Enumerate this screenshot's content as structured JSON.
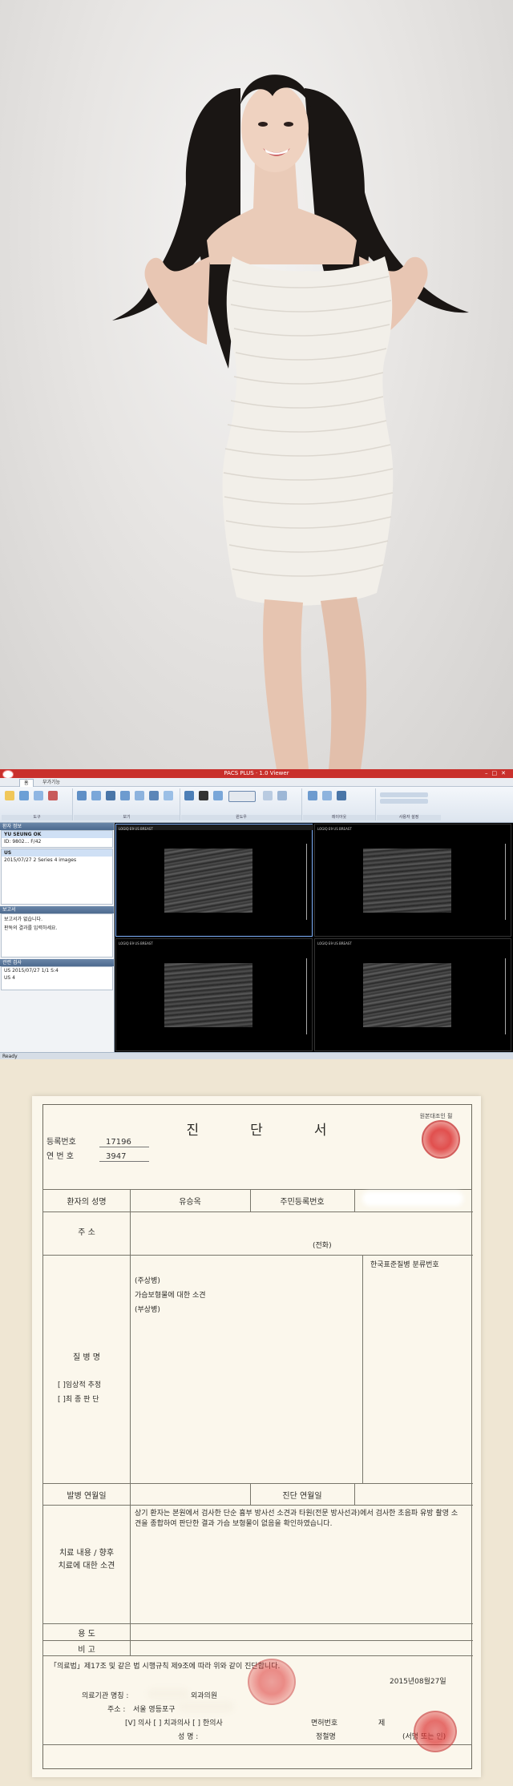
{
  "photo": {
    "subject": "woman in white bandage dress holding her long dark hair"
  },
  "viewer": {
    "window_title": "PACS PLUS · 1.0 Viewer",
    "tabs": [
      "홈",
      "부가기능"
    ],
    "ribbon_groups": [
      "도구",
      "보기",
      "윈도우",
      "레이아웃",
      "사용자 설정"
    ],
    "left_panel": {
      "patient_header": "환자 정보",
      "patient_name": "YU SEUNG OK",
      "patient_id": "ID: 9802... F/42",
      "study_header": "US",
      "study_line": "2015/07/27  2 Series  4 images",
      "report_header": "보고서",
      "report_lines": [
        "보고서가 없습니다.",
        "판독의 결과를 입력하세요."
      ],
      "related_header": "관련 검사",
      "related_lines": [
        "US 2015/07/27 1/1 S:4",
        "US  4"
      ]
    },
    "cell_info": "LOGIQ E9  US BREAST",
    "status": "Ready"
  },
  "doc": {
    "title_chars": [
      "진",
      "단",
      "서"
    ],
    "copy_label": "원본대조인 필",
    "reg_no_label": "등록번호",
    "reg_no": "17196",
    "serial_label": "연 번 호",
    "serial": "3947",
    "patient_name_label": "환자의 성명",
    "patient_name": "유승옥",
    "rrn_label": "주민등록번호",
    "address_label": "주    소",
    "phone_label": "(전화)",
    "kcd_label": "한국표준질병 분류번호",
    "main_dx_label": "(주상병)",
    "main_dx": "가슴보형물에 대한 소견",
    "sub_dx_label": "(부상병)",
    "disease_label": "질 병 명",
    "clinical_label": "[  ]임상적 추정",
    "final_label": "[  ]최 종 판 단",
    "onset_label": "발병 연월일",
    "dx_date_label": "진단 연월일",
    "treatment_label_1": "치료 내용 / 향후",
    "treatment_label_2": "치료에 대한 소견",
    "opinion": "상기 환자는 본원에서 검사한 단순 흉부 방사선 소견과 타원(전문 방사선과)에서 검사한 초음파 유방 촬영 소견을 종합하여 판단한 결과 가슴 보형물이 없음을 확인하였습니다.",
    "usage_label": "용    도",
    "remarks_label": "비    고",
    "law_text": "「의료법」제17조 및 같은 법 시행규칙 제9조에 따라 위와 같이 진단합니다.",
    "date": "2015년08월27일",
    "clinic_label": "의료기관 명칭 :",
    "clinic_suffix": "외과의원",
    "clinic_addr_label": "주소 :",
    "clinic_addr": "서울 영등포구",
    "doctor_types": "[V] 의사  [  ] 치과의사 [  ] 한의사",
    "license_label": "면허번호",
    "license_prefix": "제",
    "doctor_name_label": "성  명 :",
    "doctor_name": "정철명",
    "sign_label": "(서명 또는 인)"
  }
}
